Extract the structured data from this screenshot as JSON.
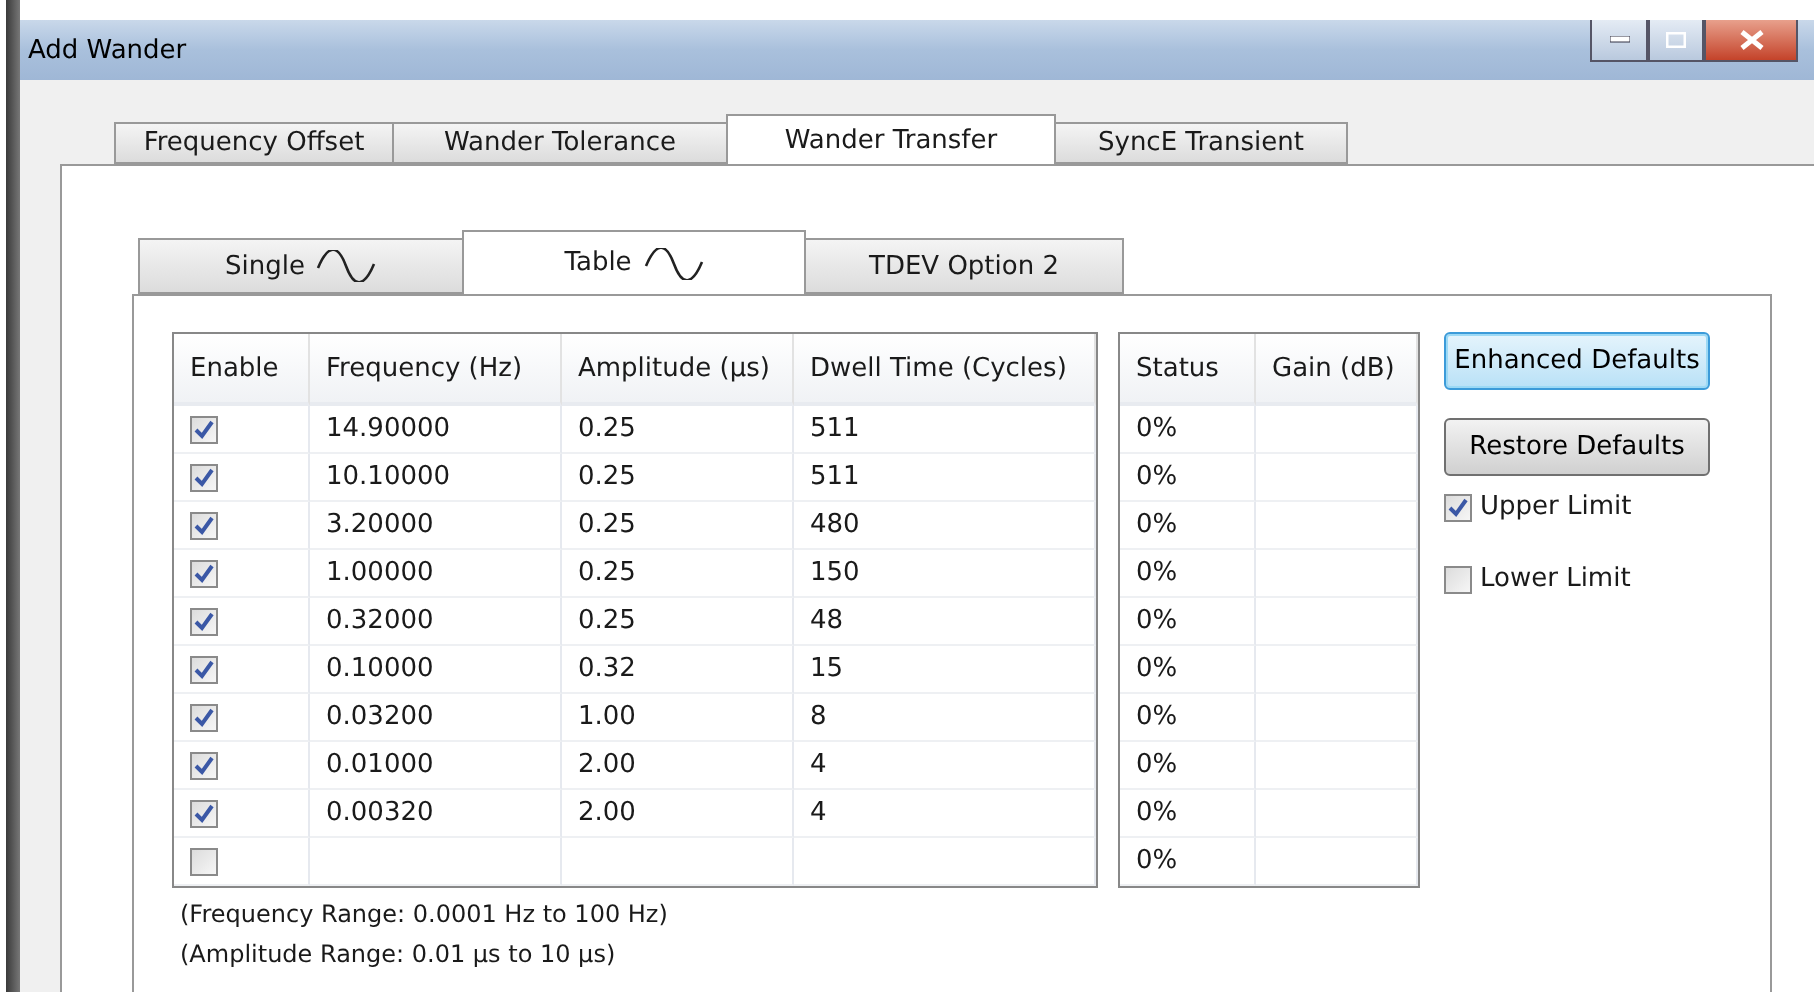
{
  "window": {
    "title": "Add Wander"
  },
  "tabs": [
    {
      "label": "Frequency Offset",
      "selected": false
    },
    {
      "label": "Wander Tolerance",
      "selected": false
    },
    {
      "label": "Wander Transfer",
      "selected": true
    },
    {
      "label": "SyncE Transient",
      "selected": false
    }
  ],
  "subtabs": [
    {
      "label": "Single",
      "selected": false,
      "wave": true
    },
    {
      "label": "Table",
      "selected": true,
      "wave": true
    },
    {
      "label": "TDEV Option 2",
      "selected": false,
      "wave": false
    }
  ],
  "table": {
    "columns": [
      "Enable",
      "Frequency (Hz)",
      "Amplitude (µs)",
      "Dwell Time (Cycles)"
    ],
    "rows": [
      {
        "checked": true,
        "cells": [
          "",
          "14.90000",
          "0.25",
          "511"
        ]
      },
      {
        "checked": true,
        "cells": [
          "",
          "10.10000",
          "0.25",
          "511"
        ]
      },
      {
        "checked": true,
        "cells": [
          "",
          "3.20000",
          "0.25",
          "480"
        ]
      },
      {
        "checked": true,
        "cells": [
          "",
          "1.00000",
          "0.25",
          "150"
        ]
      },
      {
        "checked": true,
        "cells": [
          "",
          "0.32000",
          "0.25",
          "48"
        ]
      },
      {
        "checked": true,
        "cells": [
          "",
          "0.10000",
          "0.32",
          "15"
        ]
      },
      {
        "checked": true,
        "cells": [
          "",
          "0.03200",
          "1.00",
          "8"
        ]
      },
      {
        "checked": true,
        "cells": [
          "",
          "0.01000",
          "2.00",
          "4"
        ]
      },
      {
        "checked": true,
        "cells": [
          "",
          "0.00320",
          "2.00",
          "4"
        ]
      },
      {
        "checked": false,
        "cells": []
      }
    ]
  },
  "status_table": {
    "columns": [
      "Status",
      "Gain (dB)"
    ],
    "rows": [
      [
        "0%"
      ],
      [
        "0%"
      ],
      [
        "0%"
      ],
      [
        "0%"
      ],
      [
        "0%"
      ],
      [
        "0%"
      ],
      [
        "0%"
      ],
      [
        "0%"
      ],
      [
        "0%"
      ],
      [
        "0%"
      ]
    ]
  },
  "buttons": [
    {
      "label": "Enhanced Defaults",
      "focused": true
    },
    {
      "label": "Restore Defaults",
      "focused": false
    }
  ],
  "limits": [
    {
      "label": "Upper Limit",
      "checked": true
    },
    {
      "label": "Lower Limit",
      "checked": false
    }
  ],
  "notes": [
    "(Frequency Range: 0.0001 Hz to 100 Hz)",
    "(Amplitude Range: 0.01 µs to 10 µs)"
  ]
}
